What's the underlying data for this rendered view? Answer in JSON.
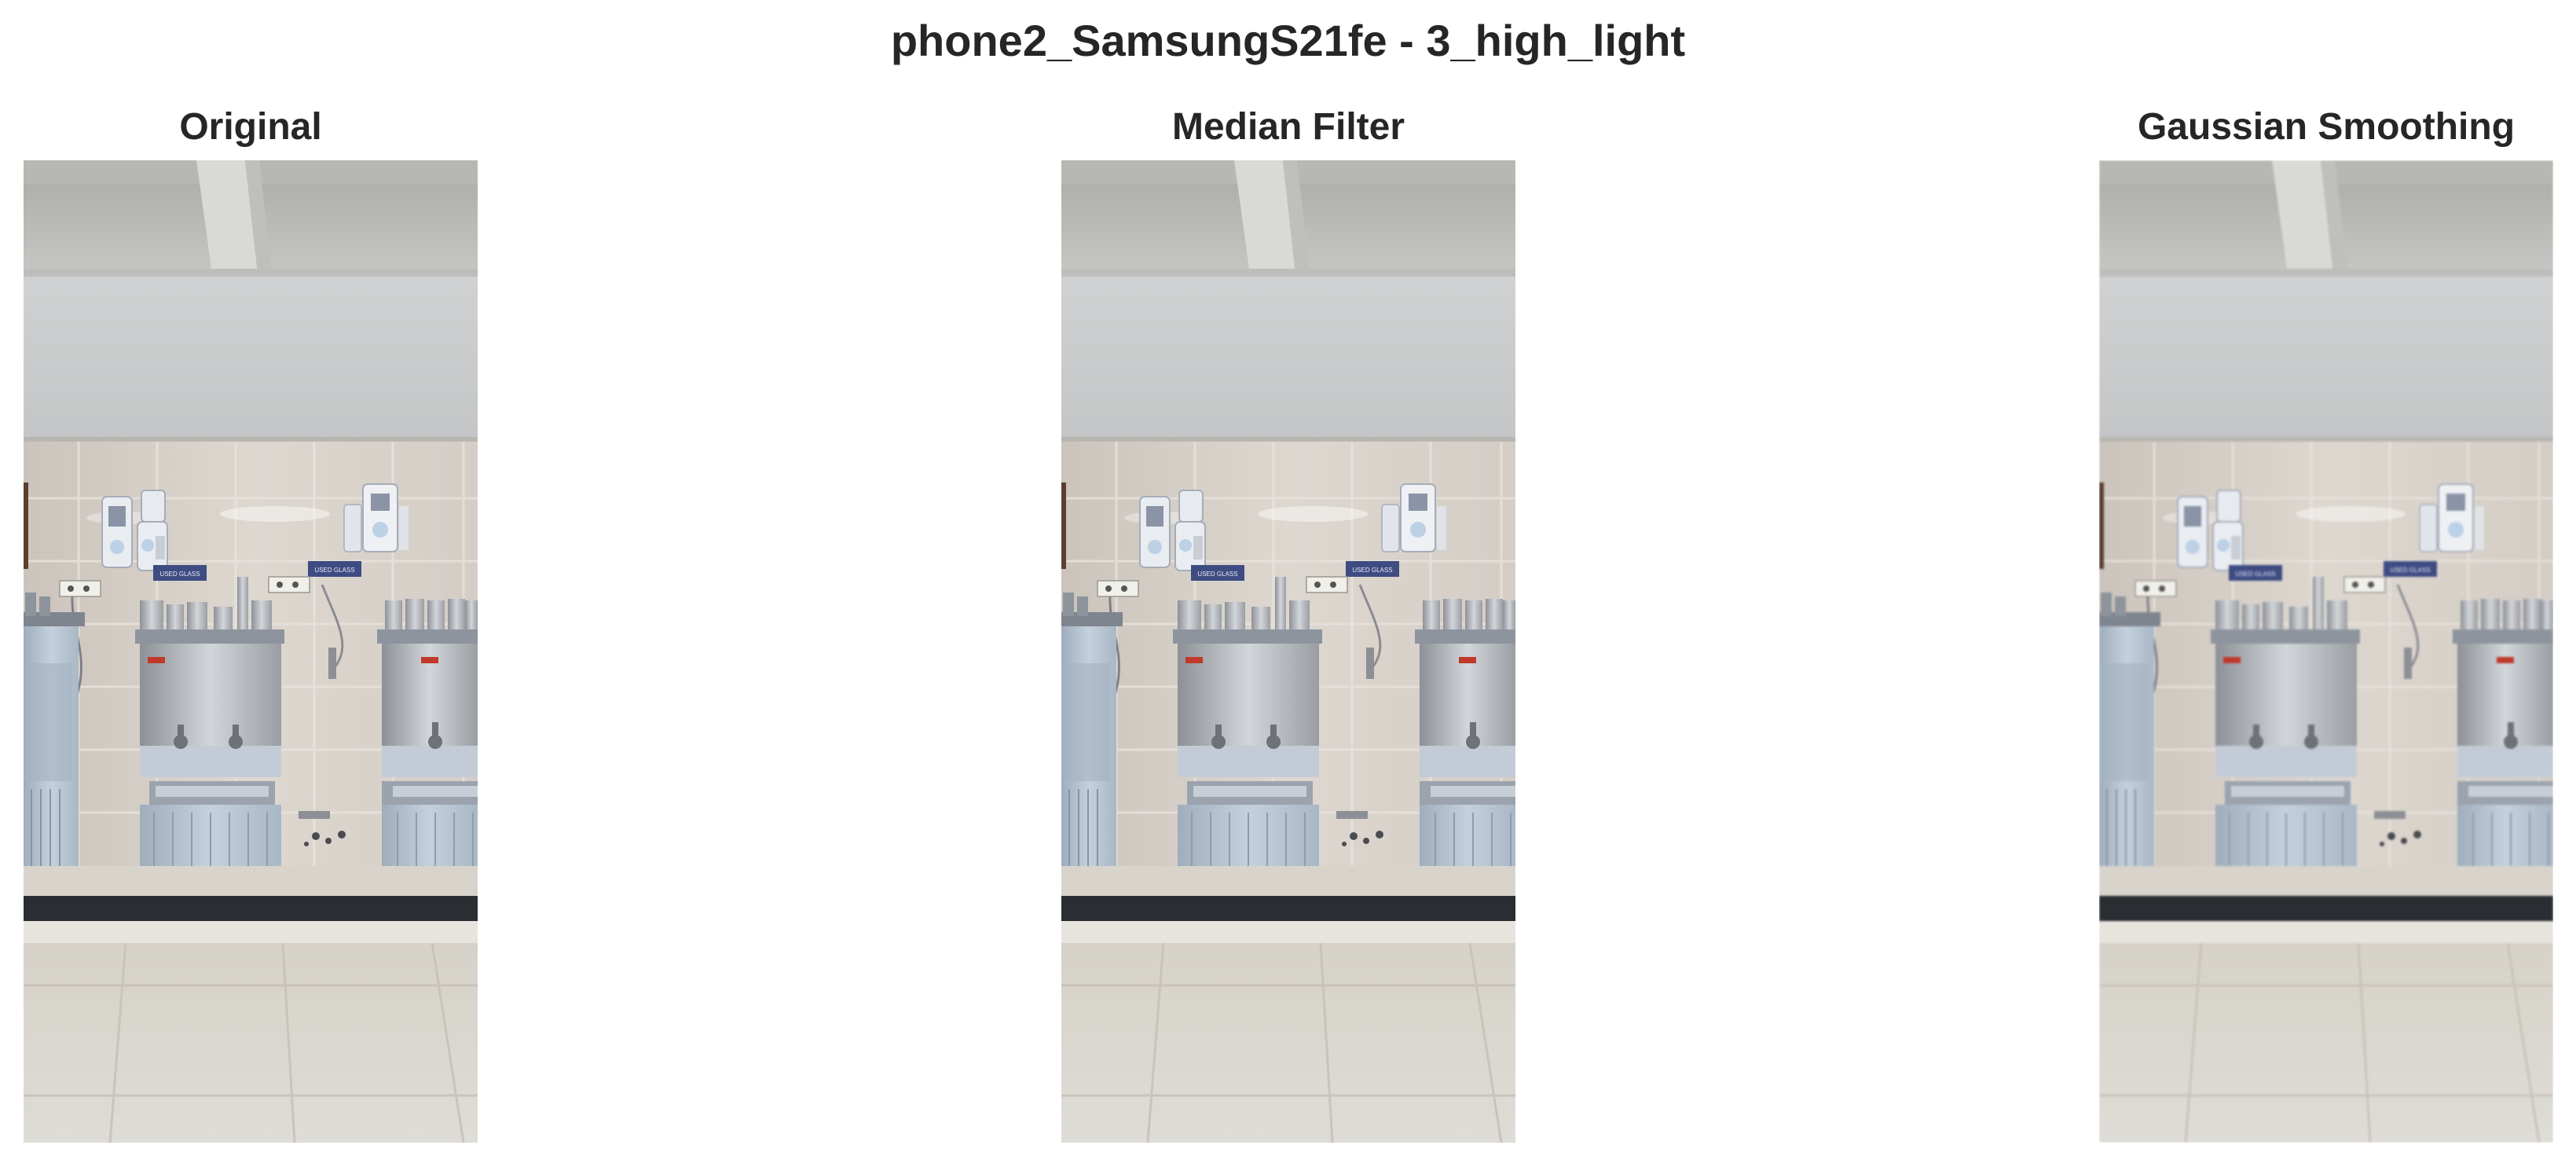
{
  "figure": {
    "title": "phone2_SamsungS21fe - 3_high_light"
  },
  "panels": [
    {
      "title": "Original"
    },
    {
      "title": "Median Filter"
    },
    {
      "title": "Gaussian Smoothing"
    }
  ],
  "scene": {
    "sign_text": "USED GLASS"
  }
}
